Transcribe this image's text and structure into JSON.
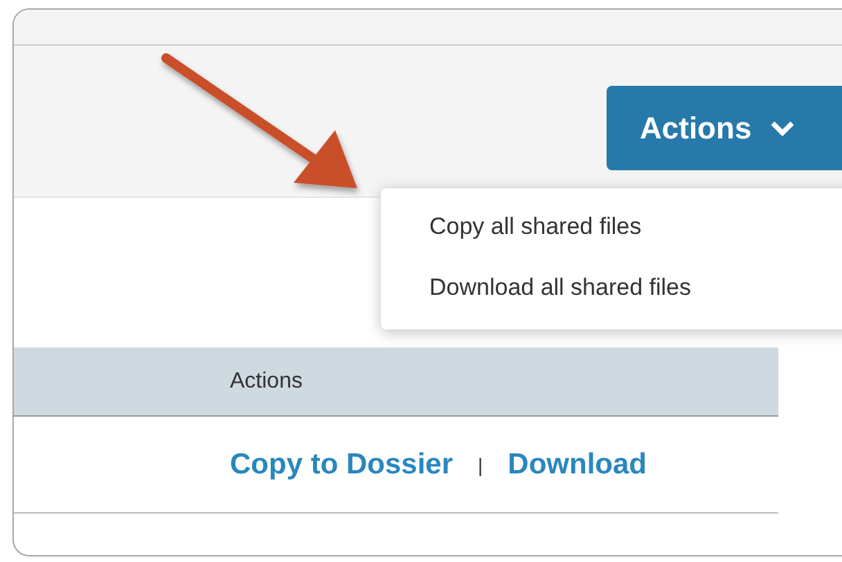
{
  "actions_button": {
    "label": "Actions"
  },
  "menu": {
    "items": [
      "Copy all shared files",
      "Download all shared files"
    ]
  },
  "table": {
    "columns": [
      "Actions"
    ],
    "rows": [
      {
        "links": [
          "Copy to Dossier",
          "Download"
        ],
        "separator": "|"
      }
    ]
  }
}
